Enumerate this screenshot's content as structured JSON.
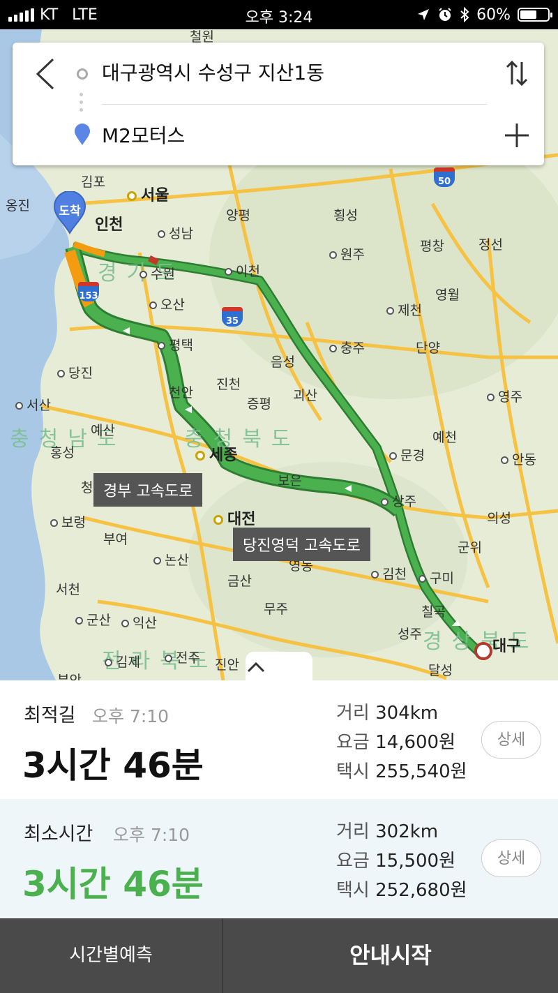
{
  "status_bar": {
    "carrier": "KT",
    "network": "LTE",
    "time": "오후 3:24",
    "battery": "60%",
    "battery_level": 0.6
  },
  "search": {
    "origin": "대구광역시 수성구 지산1동",
    "destination": "M2모터스"
  },
  "map": {
    "destination_marker": "도착",
    "route_labels": [
      "경부 고속도로",
      "당진영덕 고속도로"
    ],
    "highway_shields": [
      "50",
      "153",
      "35"
    ],
    "provinces": [
      "충청남도",
      "충청북도",
      "경상북도",
      "전라북도",
      "경기도"
    ],
    "cities": {
      "cheorwon": "철원",
      "gimpo": "김포",
      "seoul": "서울",
      "ongjin": "옹진",
      "incheon": "인천",
      "seongnam": "성남",
      "yangpyeong": "양평",
      "hoengseong": "횡성",
      "wonju": "원주",
      "pyeongchang": "평창",
      "jeongseon": "정선",
      "suwon": "수원",
      "icheon": "이천",
      "yeongwol": "영월",
      "osan": "오산",
      "jecheon": "제천",
      "pyeongtaek": "평택",
      "chungju": "충주",
      "danyang": "단양",
      "dangjin": "당진",
      "eumseong": "음성",
      "jincheon": "진천",
      "cheonan": "천안",
      "goesan": "괴산",
      "yeongju": "영주",
      "seosan": "서산",
      "jeungpyeong": "증평",
      "yesan": "예산",
      "yecheon": "예천",
      "hongseong": "홍성",
      "sejong": "세종",
      "mungyeong": "문경",
      "andong": "안동",
      "boeun": "보은",
      "sangju": "상주",
      "cheongyang": "청양",
      "boryeong": "보령",
      "daejeon": "대전",
      "uiseong": "의성",
      "buyeo": "부여",
      "gunwi": "군위",
      "nonsan": "논산",
      "yeongdong": "영동",
      "gimcheon": "김천",
      "gumi": "구미",
      "seocheon": "서천",
      "geumsan": "금산",
      "muju": "무주",
      "chilgok": "칠곡",
      "gunsan": "군산",
      "iksan": "익산",
      "seongju": "성주",
      "daegu": "대구",
      "gimje": "김제",
      "jeonju": "전주",
      "jinan": "진안",
      "dalseong": "달성",
      "buan": "부안"
    }
  },
  "routes": [
    {
      "title": "최적길",
      "arrival": "오후 7:10",
      "duration": "3시간 46분",
      "distance_label": "거리",
      "distance": "304km",
      "toll_label": "요금",
      "toll": "14,600원",
      "taxi_label": "택시",
      "taxi": "255,540원",
      "detail_button": "상세"
    },
    {
      "title": "최소시간",
      "arrival": "오후 7:10",
      "duration": "3시간 46분",
      "distance_label": "거리",
      "distance": "302km",
      "toll_label": "요금",
      "toll": "15,500원",
      "taxi_label": "택시",
      "taxi": "252,680원",
      "detail_button": "상세"
    }
  ],
  "bottom_bar": {
    "left_button": "시간별예측",
    "right_button": "안내시작"
  },
  "colors": {
    "route_green": "#4bb14f",
    "route_dark": "#2e7d32",
    "traffic_orange": "#f39c12",
    "traffic_red": "#c0392b",
    "road_yellow": "#f6c244",
    "pin_blue": "#4f7fe0"
  }
}
